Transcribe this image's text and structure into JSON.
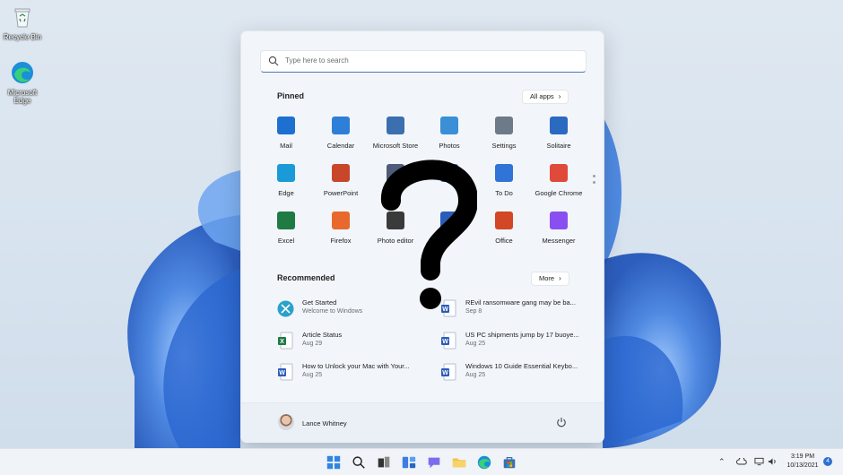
{
  "desktop": {
    "icons": [
      {
        "label": "Recycle Bin",
        "icon": "recycle-bin-icon"
      },
      {
        "label": "Microsoft Edge",
        "icon": "edge-icon"
      }
    ]
  },
  "start_menu": {
    "search_placeholder": "Type here to search",
    "pinned_title": "Pinned",
    "all_apps_label": "All apps",
    "pinned_apps": [
      {
        "label": "Mail",
        "icon": "mail-icon",
        "color": "#1d6fd0"
      },
      {
        "label": "Calendar",
        "icon": "calendar-icon",
        "color": "#2d7fd8"
      },
      {
        "label": "Microsoft Store",
        "icon": "store-icon",
        "color": "#3b6fb0"
      },
      {
        "label": "Photos",
        "icon": "photos-icon",
        "color": "#3a8fd6"
      },
      {
        "label": "Settings",
        "icon": "gear-icon",
        "color": "#6d7a88"
      },
      {
        "label": "Solitaire",
        "icon": "solitaire-icon",
        "color": "#2a6ac0"
      },
      {
        "label": "Edge",
        "icon": "edge-icon",
        "color": "#1a9ad6"
      },
      {
        "label": "PowerPoint",
        "icon": "powerpoint-icon",
        "color": "#c8472b"
      },
      {
        "label": "",
        "icon": "app-icon",
        "color": "#4f5b7a"
      },
      {
        "label": "",
        "icon": "app-icon",
        "color": "#2b6cc4"
      },
      {
        "label": "To Do",
        "icon": "todo-icon",
        "color": "#2f74d6"
      },
      {
        "label": "Google Chrome",
        "icon": "chrome-icon",
        "color": "#e04a3a"
      },
      {
        "label": "Excel",
        "icon": "excel-icon",
        "color": "#1f7a44"
      },
      {
        "label": "Firefox",
        "icon": "firefox-icon",
        "color": "#e8692b"
      },
      {
        "label": "Photo editor",
        "icon": "photo-editor-icon",
        "color": "#3a3a3a"
      },
      {
        "label": "",
        "icon": "word-icon",
        "color": "#2b5db8"
      },
      {
        "label": "Office",
        "icon": "office-icon",
        "color": "#d24726"
      },
      {
        "label": "Messenger",
        "icon": "messenger-icon",
        "color": "#8a4ff0"
      }
    ],
    "recommended_title": "Recommended",
    "more_label": "More",
    "recommended": [
      {
        "title": "Get Started",
        "subtitle": "Welcome to Windows",
        "icon": "get-started-icon"
      },
      {
        "title": "REvil ransomware gang may be ba...",
        "subtitle": "Sep 8",
        "icon": "word-icon"
      },
      {
        "title": "Article Status",
        "subtitle": "Aug 29",
        "icon": "excel-icon"
      },
      {
        "title": "US PC shipments jump by 17 buoye...",
        "subtitle": "Aug 25",
        "icon": "word-icon"
      },
      {
        "title": "How to Unlock your Mac with Your...",
        "subtitle": "Aug 25",
        "icon": "word-icon"
      },
      {
        "title": "Windows 10 Guide Essential Keybo...",
        "subtitle": "Aug 25",
        "icon": "word-icon"
      }
    ],
    "user_name": "Lance Whitney"
  },
  "taskbar": {
    "time": "3:19 PM",
    "date": "10/13/2021",
    "notification_count": "4",
    "apps": [
      "start-icon",
      "search-icon",
      "task-view-icon",
      "widgets-icon",
      "chat-icon",
      "file-explorer-icon",
      "edge-icon",
      "store-icon"
    ]
  },
  "colors": {
    "accent": "#2f6fd1",
    "wallpaper": "#3f7fe0"
  }
}
